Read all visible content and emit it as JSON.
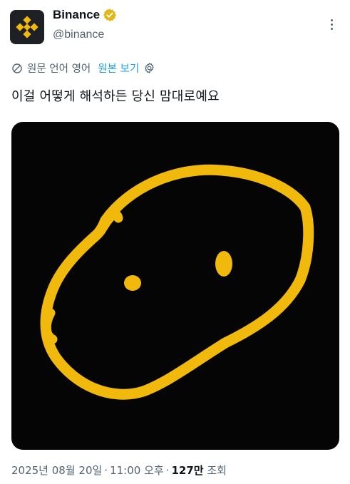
{
  "author": {
    "name": "Binance",
    "handle": "@binance"
  },
  "translation": {
    "notice": "원문 언어 영어",
    "show_original": "원본 보기"
  },
  "tweet": {
    "text": "이걸 어떻게 해석하든 당신 맘대로예요"
  },
  "meta": {
    "date": "2025년 08월 20일",
    "time": "11:00 오후",
    "views_count": "127만",
    "views_label": "조회"
  },
  "colors": {
    "brand_yellow": "#f0b90b",
    "link_blue": "#1d9bf0",
    "verified_gold": "#e2b719",
    "media_background": "#050505"
  },
  "icons": [
    "binance-logo-icon",
    "verified-badge-icon",
    "more-options-icon",
    "translate-icon",
    "settings-gear-icon"
  ]
}
